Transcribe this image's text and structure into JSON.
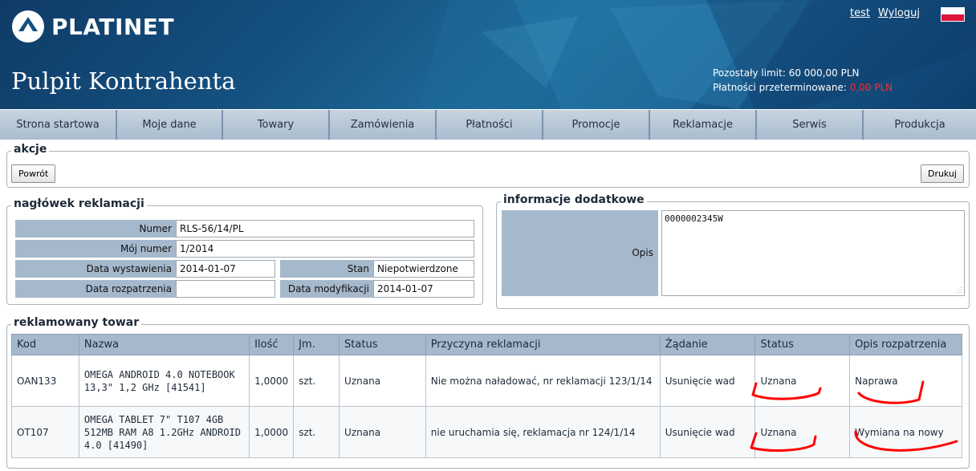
{
  "app": {
    "brand": "PLATINET",
    "title": "Pulpit Kontrahenta"
  },
  "user": {
    "username": "test",
    "logout": "Wyloguj",
    "flag": "poland-flag-icon"
  },
  "limits": {
    "limit_label": "Pozostały limit:",
    "limit_value": "60 000,00 PLN",
    "overdue_label": "Płatności przeterminowane:",
    "overdue_value": "0,00 PLN"
  },
  "nav": {
    "items": [
      {
        "label": "Strona startowa"
      },
      {
        "label": "Moje dane"
      },
      {
        "label": "Towary"
      },
      {
        "label": "Zamówienia"
      },
      {
        "label": "Płatności"
      },
      {
        "label": "Promocje"
      },
      {
        "label": "Reklamacje"
      },
      {
        "label": "Serwis"
      },
      {
        "label": "Produkcja"
      }
    ]
  },
  "actions": {
    "legend": "akcje",
    "back": "Powrót",
    "print": "Drukuj"
  },
  "claim_header": {
    "legend": "nagłówek reklamacji",
    "numer_label": "Numer",
    "numer_value": "RLS-56/14/PL",
    "moj_numer_label": "Mój numer",
    "moj_numer_value": "1/2014",
    "data_wystawienia_label": "Data wystawienia",
    "data_wystawienia_value": "2014-01-07",
    "stan_label": "Stan",
    "stan_value": "Niepotwierdzone",
    "data_rozpatrzenia_label": "Data rozpatrzenia",
    "data_rozpatrzenia_value": "",
    "data_modyfikacji_label": "Data modyfikacji",
    "data_modyfikacji_value": "2014-01-07"
  },
  "additional": {
    "legend": "informacje dodatkowe",
    "opis_label": "Opis",
    "opis_value": "0000002345W"
  },
  "items": {
    "legend": "reklamowany towar",
    "columns": [
      "Kod",
      "Nazwa",
      "Ilość",
      "Jm.",
      "Status",
      "Przyczyna reklamacji",
      "Żądanie",
      "Status",
      "Opis rozpatrzenia"
    ],
    "rows": [
      {
        "kod": "OAN133",
        "nazwa": "OMEGA ANDROID 4.0 NOTEBOOK 13,3\" 1,2 GHz [41541]",
        "ilosc": "1,0000",
        "jm": "szt.",
        "status": "Uznana",
        "przyczyna": "Nie można naładować, nr reklamacji 123/1/14",
        "zadanie": "Usunięcie wad",
        "status2": "Uznana",
        "opis": "Naprawa"
      },
      {
        "kod": "OT107",
        "nazwa": "OMEGA TABLET 7\" T107 4GB 512MB RAM A8 1.2GHz ANDROID 4.0 [41490]",
        "ilosc": "1,0000",
        "jm": "szt.",
        "status": "Uznana",
        "przyczyna": "nie uruchamia się, reklamacja nr 124/1/14",
        "zadanie": "Usunięcie wad",
        "status2": "Uznana",
        "opis": "Wymiana na nowy"
      }
    ]
  },
  "colors": {
    "header_blue": "#14507f",
    "label_bg": "#a6b8cc",
    "overdue_red": "#ff2a2a",
    "annotation_red": "#ff0000"
  }
}
